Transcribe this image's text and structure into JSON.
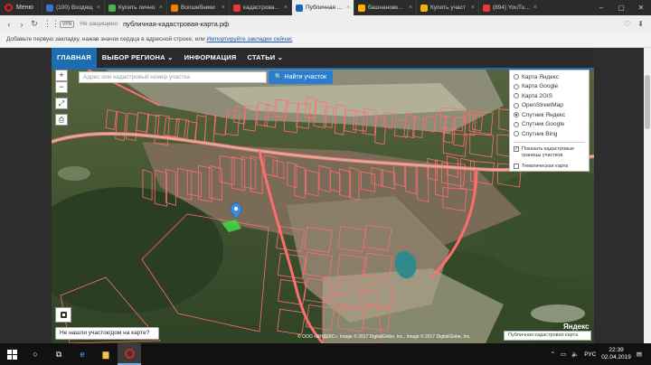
{
  "browser": {
    "menu_label": "Меню",
    "tabs": [
      {
        "label": "(100) Входящ",
        "color": "#3b6fd4",
        "active": false
      },
      {
        "label": "Купить лично",
        "color": "#4caf50",
        "active": false
      },
      {
        "label": "Волшебники",
        "color": "#f57c00",
        "active": false
      },
      {
        "label": "кадастровая к",
        "color": "#e53935",
        "active": false
      },
      {
        "label": "Публичная кад",
        "color": "#1565c0",
        "active": true
      },
      {
        "label": "башнановка 6",
        "color": "#ffb300",
        "active": false
      },
      {
        "label": "Купить участ",
        "color": "#f5b400",
        "active": false
      },
      {
        "label": "(894) YouTube",
        "color": "#e53935",
        "active": false
      }
    ],
    "tab_close_glyph": "×",
    "window_controls": [
      "–",
      "▢",
      "✕"
    ],
    "nav": {
      "back": "‹",
      "forward": "›",
      "reload": "↻",
      "apps": "⋮⋮"
    },
    "vpn_label": "VPN",
    "secure_label": "Не защищено",
    "url": "публичная-кадастровая-карта.рф",
    "bookmark_bar": {
      "text": "Добавьте первую закладку, нажав значок сердца в адресной строке, или",
      "link": "Импортируйте закладки сейчас"
    },
    "addr_icons": [
      "♡",
      "⬇"
    ]
  },
  "site_nav": {
    "items": [
      "ГЛАВНАЯ",
      "ВЫБОР РЕГИОНА ⌄",
      "ИНФОРМАЦИЯ",
      "СТАТЬИ ⌄"
    ]
  },
  "map": {
    "search_placeholder": "Адрес или кадастровый номер участка",
    "find_button": "🔍 Найти участок",
    "zoom_in": "+",
    "zoom_out": "−",
    "fullscreen": "⤢",
    "print": "⎙",
    "layers": [
      {
        "label": "Карта Яндекс",
        "selected": false
      },
      {
        "label": "Карта Google",
        "selected": false
      },
      {
        "label": "Карта 2GIS",
        "selected": false
      },
      {
        "label": "OpenStreetMap",
        "selected": false
      },
      {
        "label": "Спутник Яндекс",
        "selected": true
      },
      {
        "label": "Спутник Google",
        "selected": false
      },
      {
        "label": "Спутник Bing",
        "selected": false
      }
    ],
    "options": [
      {
        "label": "Показать кадастровые границы участков",
        "checked": true
      },
      {
        "label": "Тематическая карта",
        "checked": false
      }
    ],
    "not_found_button": "Не нашли участок/дом на карте?",
    "copyright": "© ООО «ЯНДЕКС», Image © 2017 DigitalGlobe, Inc., Image © 2017 DigitalGlobe, Inc.",
    "pkk_button": "Публичная кадастровая карта",
    "yandex_mark": "Яндекс"
  },
  "taskbar": {
    "language": "РУС",
    "time": "22:39",
    "date": "02.04.2019"
  },
  "colors": {
    "nav_accent": "#1d6eb0",
    "parcel_line": "#ff6e6e"
  }
}
